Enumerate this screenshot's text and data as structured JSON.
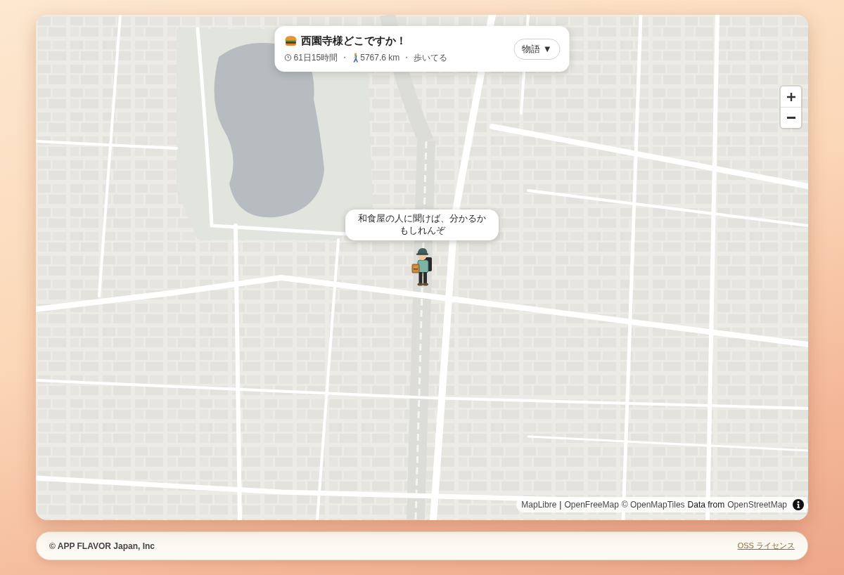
{
  "header": {
    "title": "西園寺様どこですか！",
    "stats": [
      {
        "kind": "time",
        "text": "61日15時間"
      },
      {
        "kind": "separator",
        "text": "・"
      },
      {
        "kind": "distance",
        "text": "5767.6 km"
      },
      {
        "kind": "separator",
        "text": "・"
      },
      {
        "kind": "status",
        "text": "歩いてる"
      }
    ],
    "story_button": {
      "label": "物語 ▼"
    }
  },
  "speech_bubble": {
    "text": "和食屋の人に聞けば、分かるかもしれんぞ"
  },
  "attribution": {
    "parts": [
      {
        "kind": "link",
        "text": "MapLibre"
      },
      {
        "kind": "text",
        "text": "|"
      },
      {
        "kind": "link",
        "text": "OpenFreeMap"
      },
      {
        "kind": "link",
        "text": "© OpenMapTiles"
      },
      {
        "kind": "text",
        "text": "Data from"
      },
      {
        "kind": "link",
        "text": "OpenStreetMap"
      }
    ]
  },
  "footer": {
    "copyright": "© APP FLAVOR Japan, Inc",
    "license_link": "OSS ライセンス"
  }
}
